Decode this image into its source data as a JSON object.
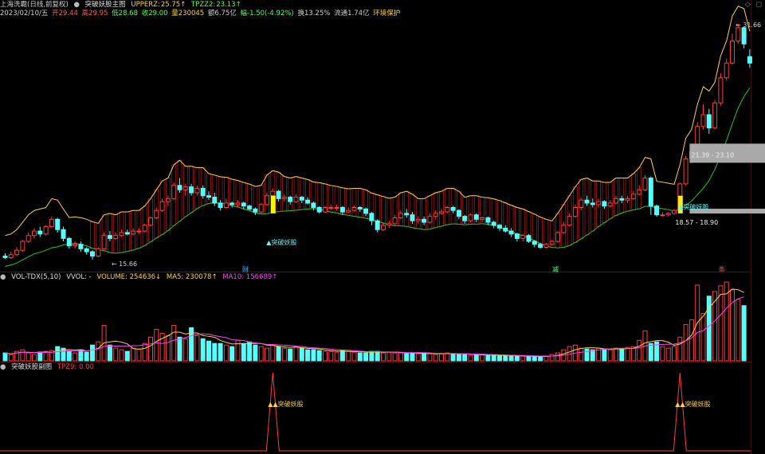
{
  "main_header": {
    "stock": "上海洗霸(日线,前复权)",
    "indicator": "突破妖股主图",
    "upperz_label": "UPPERZ:",
    "upperz_value": "25.75↑",
    "tpzz_label": "TPZZ2:",
    "tpzz_value": "23.13↑"
  },
  "quote_line": {
    "date": "2023/02/10/五",
    "open": "开29.44",
    "high": "高29.95",
    "low": "低28.68",
    "close": "收29.00",
    "volume": "量230045",
    "amount": "额6.75亿",
    "change": "幅-1.50(-4.92%)",
    "turnover": "换13.25%",
    "float": "流通1.74亿",
    "tag": "环境保护"
  },
  "corner_icons": "◇ ◻",
  "price_labels": {
    "high": "31.66",
    "low": "15.66",
    "box_upper": "21.39 - 23.10",
    "box_lower": "18.57 - 18.90",
    "signal": "▲突破妖股",
    "signal_right": "▲突破妖股"
  },
  "event_markers": [
    "财",
    "减",
    "条"
  ],
  "vol_header": {
    "title": "VOL-TDX(5,10)",
    "vvol": "VVOL: -",
    "volume": "VOLUME: 254636↓",
    "ma5": "MA5: 230078↑",
    "ma10": "MA10: 156689↑"
  },
  "sub_header": {
    "title": "突破妖股副图",
    "tpz": "TPZ9: 0.00"
  },
  "sub_labels": [
    "▲▲突破妖股",
    "▲▲突破妖股"
  ],
  "colors": {
    "up": "#ff3b3b",
    "down": "#54ffff",
    "ma_yellow": "#ffd23c",
    "ma_magenta": "#ff3cff",
    "green": "#1ec81e",
    "box": "#a9a9a9",
    "signal_bar": "#f5f500"
  },
  "chart_data": {
    "type": "candlestick",
    "price_range": [
      15.66,
      31.66
    ],
    "candles": [
      [
        15.9,
        15.8,
        16.1,
        15.7
      ],
      [
        15.8,
        16.0,
        16.2,
        15.7
      ],
      [
        16.0,
        16.3,
        16.5,
        15.9
      ],
      [
        16.3,
        16.9,
        17.0,
        16.2
      ],
      [
        16.9,
        17.3,
        17.5,
        16.8
      ],
      [
        17.3,
        17.6,
        17.8,
        17.1
      ],
      [
        17.6,
        17.4,
        17.9,
        17.2
      ],
      [
        17.4,
        17.9,
        18.0,
        17.3
      ],
      [
        17.9,
        18.4,
        18.6,
        17.8
      ],
      [
        18.4,
        17.7,
        18.5,
        17.5
      ],
      [
        17.7,
        17.1,
        17.9,
        16.9
      ],
      [
        17.1,
        16.6,
        17.2,
        16.4
      ],
      [
        16.6,
        16.7,
        16.9,
        16.4
      ],
      [
        16.7,
        16.4,
        16.9,
        16.2
      ],
      [
        16.4,
        16.2,
        16.5,
        16.0
      ],
      [
        16.2,
        15.9,
        16.3,
        15.66
      ],
      [
        15.9,
        16.4,
        16.5,
        15.8
      ],
      [
        16.4,
        17.3,
        17.5,
        16.3
      ],
      [
        17.3,
        17.1,
        17.6,
        16.9
      ],
      [
        17.1,
        17.3,
        17.5,
        17.0
      ],
      [
        17.3,
        17.5,
        17.7,
        17.2
      ],
      [
        17.5,
        17.4,
        17.7,
        17.3
      ],
      [
        17.4,
        17.6,
        17.8,
        17.3
      ],
      [
        17.6,
        17.6,
        17.8,
        17.4
      ],
      [
        17.6,
        18.0,
        18.1,
        17.5
      ],
      [
        18.0,
        18.5,
        18.6,
        17.9
      ],
      [
        18.5,
        19.0,
        19.2,
        18.4
      ],
      [
        19.0,
        19.6,
        19.8,
        18.9
      ],
      [
        19.6,
        19.8,
        20.0,
        19.3
      ],
      [
        19.8,
        20.7,
        20.9,
        19.7
      ],
      [
        20.7,
        20.4,
        21.2,
        20.2
      ],
      [
        20.4,
        20.6,
        20.8,
        20.0
      ],
      [
        20.6,
        20.2,
        20.8,
        20.0
      ],
      [
        20.2,
        20.5,
        20.7,
        20.0
      ],
      [
        20.5,
        20.0,
        20.7,
        19.8
      ],
      [
        20.0,
        19.9,
        20.3,
        19.7
      ],
      [
        19.9,
        19.5,
        20.2,
        19.3
      ],
      [
        19.5,
        19.2,
        19.7,
        19.0
      ],
      [
        19.2,
        19.5,
        19.8,
        19.1
      ],
      [
        19.5,
        19.4,
        19.6,
        19.2
      ],
      [
        19.4,
        19.5,
        19.7,
        19.2
      ],
      [
        19.5,
        19.3,
        19.6,
        19.1
      ],
      [
        19.3,
        19.1,
        19.4,
        19.0
      ],
      [
        19.1,
        18.9,
        19.2,
        18.7
      ],
      [
        18.9,
        19.4,
        19.5,
        18.8
      ],
      [
        19.4,
        20.0,
        20.2,
        19.3
      ],
      [
        20.0,
        20.3,
        20.5,
        19.9
      ],
      [
        20.3,
        19.8,
        20.4,
        19.6
      ],
      [
        19.8,
        19.9,
        20.1,
        19.6
      ],
      [
        19.9,
        19.6,
        20.0,
        19.4
      ],
      [
        19.6,
        19.9,
        20.1,
        19.5
      ],
      [
        19.9,
        19.7,
        20.0,
        19.5
      ],
      [
        19.7,
        19.5,
        19.9,
        19.4
      ],
      [
        19.5,
        19.2,
        19.6,
        19.0
      ],
      [
        19.2,
        18.9,
        19.3,
        18.8
      ],
      [
        18.9,
        19.2,
        19.3,
        18.8
      ],
      [
        19.2,
        19.2,
        19.4,
        19.0
      ],
      [
        19.2,
        19.2,
        19.4,
        19.0
      ],
      [
        19.2,
        18.9,
        19.3,
        18.7
      ],
      [
        18.9,
        19.0,
        19.2,
        18.8
      ],
      [
        19.0,
        19.2,
        19.3,
        18.9
      ],
      [
        19.2,
        19.1,
        19.3,
        18.9
      ],
      [
        19.1,
        18.8,
        19.2,
        18.6
      ],
      [
        18.8,
        18.3,
        18.9,
        18.0
      ],
      [
        18.3,
        17.7,
        18.4,
        17.5
      ],
      [
        17.7,
        18.0,
        18.2,
        17.6
      ],
      [
        18.0,
        18.1,
        18.3,
        17.8
      ],
      [
        18.1,
        18.5,
        18.7,
        18.0
      ],
      [
        18.5,
        18.8,
        19.0,
        18.4
      ],
      [
        18.8,
        18.7,
        19.1,
        18.5
      ],
      [
        18.7,
        18.3,
        18.9,
        18.1
      ],
      [
        18.3,
        18.4,
        18.6,
        18.1
      ],
      [
        18.4,
        18.2,
        18.6,
        18.0
      ],
      [
        18.2,
        18.6,
        18.8,
        18.1
      ],
      [
        18.6,
        18.8,
        19.0,
        18.4
      ],
      [
        18.8,
        18.9,
        19.1,
        18.7
      ],
      [
        18.9,
        19.2,
        19.3,
        18.8
      ],
      [
        19.2,
        19.0,
        19.3,
        18.8
      ],
      [
        19.0,
        18.6,
        19.1,
        18.4
      ],
      [
        18.6,
        18.3,
        18.7,
        18.1
      ],
      [
        18.3,
        18.7,
        18.8,
        18.2
      ],
      [
        18.7,
        18.4,
        18.8,
        18.2
      ],
      [
        18.4,
        18.5,
        18.6,
        18.2
      ],
      [
        18.5,
        18.2,
        18.6,
        18.0
      ],
      [
        18.2,
        18.0,
        18.3,
        17.8
      ],
      [
        18.0,
        17.8,
        18.1,
        17.6
      ],
      [
        17.8,
        17.6,
        18.0,
        17.5
      ],
      [
        17.6,
        17.4,
        17.8,
        17.2
      ],
      [
        17.4,
        17.1,
        17.5,
        16.9
      ],
      [
        17.1,
        17.3,
        17.4,
        16.9
      ],
      [
        17.3,
        16.9,
        17.4,
        16.8
      ],
      [
        16.9,
        16.7,
        17.0,
        16.5
      ],
      [
        16.7,
        16.5,
        16.8,
        16.4
      ],
      [
        16.5,
        16.7,
        16.8,
        16.4
      ],
      [
        16.7,
        16.9,
        17.0,
        16.6
      ],
      [
        16.9,
        17.5,
        17.6,
        16.8
      ],
      [
        17.5,
        18.0,
        18.2,
        17.4
      ],
      [
        18.0,
        18.6,
        18.8,
        17.9
      ],
      [
        18.6,
        19.2,
        19.4,
        18.5
      ],
      [
        19.2,
        19.7,
        19.9,
        19.0
      ],
      [
        19.7,
        19.5,
        20.0,
        19.3
      ],
      [
        19.5,
        19.4,
        19.8,
        19.2
      ],
      [
        19.4,
        19.6,
        19.8,
        19.2
      ],
      [
        19.6,
        19.3,
        19.7,
        19.1
      ],
      [
        19.3,
        19.5,
        19.7,
        19.2
      ],
      [
        19.5,
        19.8,
        20.0,
        19.4
      ],
      [
        19.8,
        19.7,
        20.0,
        19.5
      ],
      [
        19.7,
        19.8,
        20.0,
        19.5
      ],
      [
        19.8,
        20.1,
        20.3,
        19.7
      ],
      [
        20.1,
        20.4,
        20.7,
        20.0
      ],
      [
        20.4,
        21.2,
        21.4,
        20.3
      ],
      [
        21.2,
        19.3,
        21.3,
        18.7
      ],
      [
        19.3,
        18.7,
        19.4,
        18.57
      ],
      [
        18.7,
        18.7,
        18.9,
        18.57
      ],
      [
        18.7,
        18.8,
        18.9,
        18.6
      ],
      [
        18.8,
        19.0,
        19.1,
        18.7
      ],
      [
        19.0,
        20.8,
        20.9,
        18.9
      ],
      [
        20.8,
        22.5,
        22.7,
        20.7
      ],
      [
        22.5,
        23.0,
        23.3,
        22.2
      ],
      [
        23.0,
        24.7,
        25.0,
        22.8
      ],
      [
        24.7,
        25.5,
        26.2,
        24.5
      ],
      [
        25.5,
        24.6,
        25.9,
        24.2
      ],
      [
        24.6,
        26.3,
        26.5,
        24.5
      ],
      [
        26.3,
        28.0,
        28.3,
        26.1
      ],
      [
        28.0,
        29.0,
        29.3,
        27.8
      ],
      [
        29.0,
        30.5,
        31.0,
        28.9
      ],
      [
        30.5,
        31.4,
        31.66,
        30.3
      ],
      [
        31.4,
        30.3,
        31.5,
        30.0
      ],
      [
        29.44,
        29.0,
        29.95,
        28.68
      ]
    ],
    "volumes": [
      0.1,
      0.08,
      0.12,
      0.14,
      0.1,
      0.08,
      0.11,
      0.12,
      0.13,
      0.18,
      0.16,
      0.12,
      0.1,
      0.14,
      0.11,
      0.2,
      0.24,
      0.45,
      0.2,
      0.16,
      0.14,
      0.12,
      0.16,
      0.15,
      0.22,
      0.3,
      0.4,
      0.35,
      0.32,
      0.45,
      0.3,
      0.28,
      0.42,
      0.32,
      0.28,
      0.25,
      0.22,
      0.22,
      0.2,
      0.18,
      0.26,
      0.22,
      0.24,
      0.2,
      0.18,
      0.16,
      0.2,
      0.18,
      0.16,
      0.15,
      0.18,
      0.16,
      0.14,
      0.14,
      0.13,
      0.12,
      0.12,
      0.11,
      0.13,
      0.12,
      0.11,
      0.1,
      0.1,
      0.12,
      0.12,
      0.1,
      0.11,
      0.1,
      0.1,
      0.09,
      0.1,
      0.09,
      0.1,
      0.09,
      0.08,
      0.09,
      0.1,
      0.09,
      0.08,
      0.08,
      0.07,
      0.07,
      0.08,
      0.07,
      0.07,
      0.06,
      0.07,
      0.06,
      0.06,
      0.06,
      0.05,
      0.05,
      0.06,
      0.06,
      0.08,
      0.1,
      0.14,
      0.18,
      0.2,
      0.16,
      0.15,
      0.14,
      0.16,
      0.15,
      0.14,
      0.16,
      0.15,
      0.17,
      0.18,
      0.26,
      0.38,
      0.22,
      0.24,
      0.18,
      0.16,
      0.18,
      0.3,
      0.46,
      0.52,
      0.96,
      0.6,
      0.82,
      0.88,
      0.95,
      1.0,
      0.9,
      0.78,
      0.7
    ],
    "ma_lines": [
      "MA5",
      "MA10"
    ]
  }
}
